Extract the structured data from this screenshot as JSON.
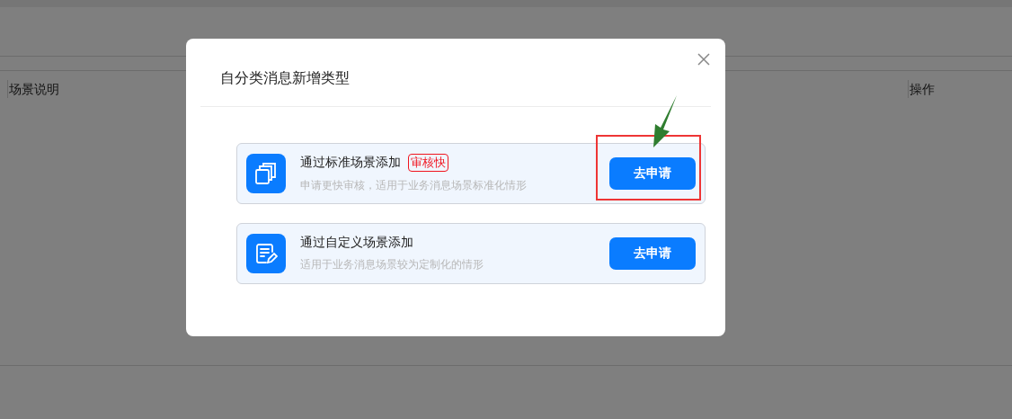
{
  "table": {
    "columns": [
      {
        "label": "场景说明"
      },
      {
        "label": "操作"
      }
    ]
  },
  "dialog": {
    "title": "自分类消息新增类型",
    "options": [
      {
        "kind": "standard",
        "title": "通过标准场景添加",
        "badge": "审核快",
        "description": "申请更快审核，适用于业务消息场景标准化情形",
        "button": "去申请",
        "highlighted": true
      },
      {
        "kind": "custom",
        "title": "通过自定义场景添加",
        "description": "适用于业务消息场景较为定制化的情形",
        "button": "去申请",
        "highlighted": false
      }
    ]
  }
}
